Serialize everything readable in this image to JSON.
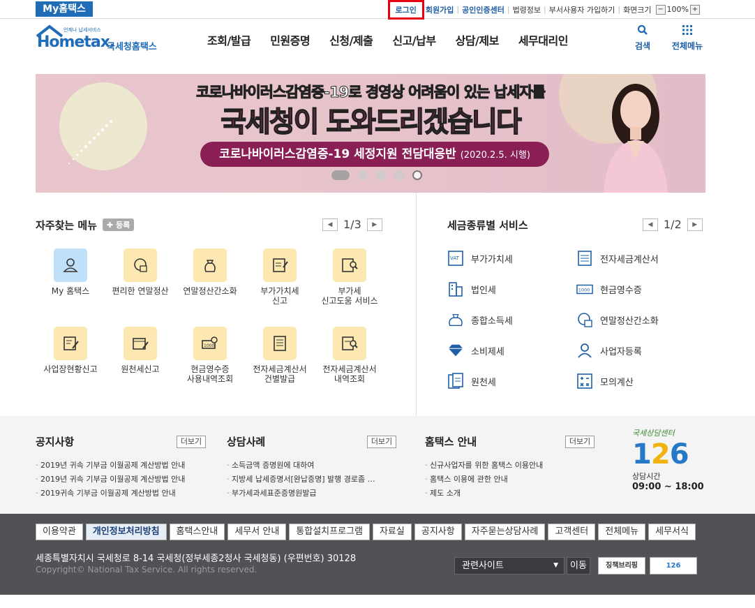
{
  "topbar": {
    "my_hometax": "My홈택스",
    "login": "로그인",
    "signup": "회원가입",
    "cert_center": "공인인증센터",
    "law_info": "법령정보",
    "dept_user_signup": "부서사용자 가입하기",
    "screen_size": "화면크기",
    "zoom_minus": "−",
    "zoom_value": "100%",
    "zoom_plus": "+"
  },
  "header": {
    "logo_small": "언제나 납세서비스",
    "logo_main": "Hometax.",
    "logo_sub": "국세청홈택스",
    "nav": [
      "조회/발급",
      "민원증명",
      "신청/제출",
      "신고/납부",
      "상담/제보",
      "세무대리인"
    ],
    "search_label": "검색",
    "all_menu_label": "전체메뉴"
  },
  "banner": {
    "line1": "코로나바이러스감염증-19로 경영상 어려움이 있는 납세자를",
    "line2": "국세청이 도와드리겠습니다",
    "pill_main": "코로나바이러스감염증-19 세정지원 전담대응반",
    "pill_date": "(2020.2.5. 시행)"
  },
  "favorites": {
    "title": "자주찾는 메뉴",
    "register": "등록",
    "page": "1/3",
    "items": [
      {
        "label1": "My 홈택스",
        "label2": ""
      },
      {
        "label1": "편리한 연말정산",
        "label2": ""
      },
      {
        "label1": "연말정산간소화",
        "label2": ""
      },
      {
        "label1": "부가가치세",
        "label2": "신고"
      },
      {
        "label1": "부가세",
        "label2": "신고도움 서비스"
      },
      {
        "label1": "사업장현황신고",
        "label2": ""
      },
      {
        "label1": "원천세신고",
        "label2": ""
      },
      {
        "label1": "현금영수증",
        "label2": "사용내역조회"
      },
      {
        "label1": "전자세금계산서",
        "label2": "건별발급"
      },
      {
        "label1": "전자세금계산서",
        "label2": "내역조회"
      }
    ]
  },
  "tax_services": {
    "title": "세금종류별 서비스",
    "page": "1/2",
    "items": [
      "부가가치세",
      "전자세금계산서",
      "법인세",
      "현금영수증",
      "종합소득세",
      "연말정산간소화",
      "소비제세",
      "사업자등록",
      "원천세",
      "모의계산"
    ]
  },
  "notices": {
    "more": "더보기",
    "notice_title": "공지사항",
    "notice_items": [
      "2019년 귀속 기부금 이월공제 계산방법 안내",
      "2019년 귀속 기부금 이월공제 계산방법 안내",
      "2019귀속 기부금 이월공제 계산방법 안내"
    ],
    "consult_title": "상담사례",
    "consult_items": [
      "소득금액 증명원에 대하여",
      "지방세 납세증명서[완납증명] 발행 경로좀 …",
      "부가세과세표준증명원발급"
    ],
    "guide_title": "홈택스 안내",
    "guide_items": [
      "신규사업자를 위한 홈택스 이용안내",
      "홈택스 이용에 관한 안내",
      "제도 소개"
    ],
    "center_title": "국세상담센터",
    "center_number": "126",
    "center_hours_label": "상담시간",
    "center_hours": "09:00 ~ 18:00"
  },
  "footer": {
    "links": [
      "이용약관",
      "개인정보처리방침",
      "홈택스안내",
      "세무서 안내",
      "통합설치프로그램",
      "자료실",
      "공지사항",
      "자주묻는상담사례",
      "고객센터",
      "전체메뉴",
      "세무서식"
    ],
    "address": "세종특별자치시 국세청로 8-14 국세청(정부세종2청사 국세청동) (우편번호) 30128",
    "copyright": "Copyright© National Tax Service. All rights reserved.",
    "related_site": "관련사이트",
    "go": "이동",
    "badge1": "징책브리핑",
    "badge2": "126"
  },
  "colors": {
    "brand_blue": "#1f6cb8",
    "login_highlight": "#e60012",
    "footer_bg": "#505256",
    "icon_bg": "#fde8b2"
  }
}
